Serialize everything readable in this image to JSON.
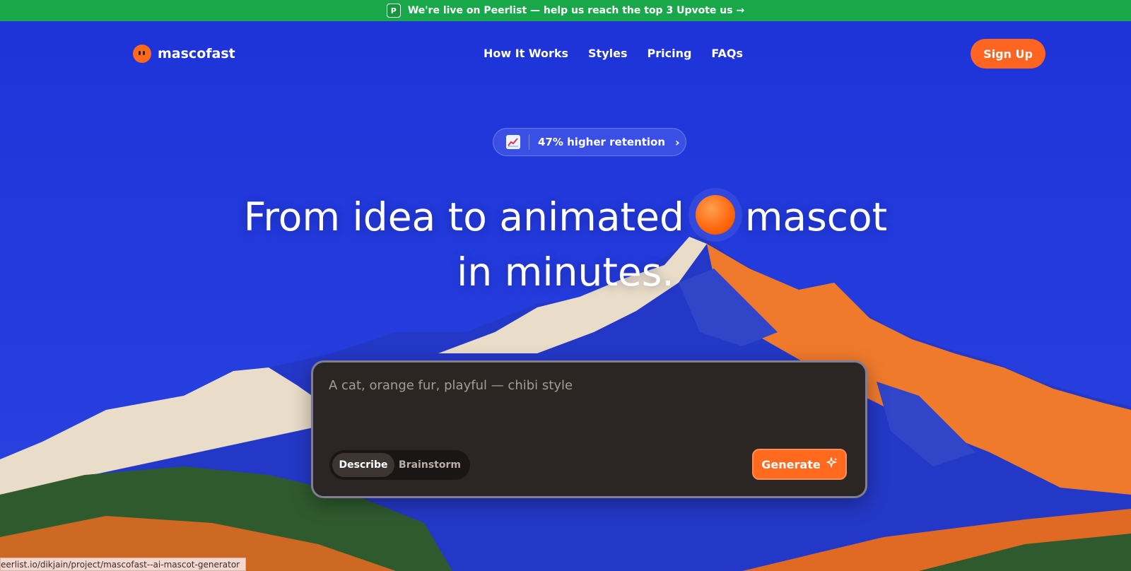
{
  "announcement": {
    "badge": "P",
    "text": "We're live on Peerlist — help us reach the top 3 Upvote us →"
  },
  "nav": {
    "logo_text": "mascofast",
    "links": [
      "How It Works",
      "Styles",
      "Pricing",
      "FAQs"
    ],
    "signup_label": "Sign Up"
  },
  "hero": {
    "pill_text": "47% higher retention",
    "pill_icon": "chart-increasing-icon",
    "headline_line1_a": "From idea to animated",
    "headline_line1_b": "mascot",
    "headline_line2": "in minutes."
  },
  "composer": {
    "placeholder": "A cat, orange fur, playful — chibi style",
    "mode_active": "Describe",
    "mode_inactive": "Brainstorm",
    "generate_label": "Generate",
    "generate_icon": "sparkle-icon"
  },
  "statusbar": {
    "url": "eerlist.io/dikjain/project/mascofast--ai-mascot-generator"
  },
  "colors": {
    "announcement_bg": "#18a84a",
    "sky": "#1f35d6",
    "accent": "#ff6520",
    "card_bg": "#2b2523"
  }
}
